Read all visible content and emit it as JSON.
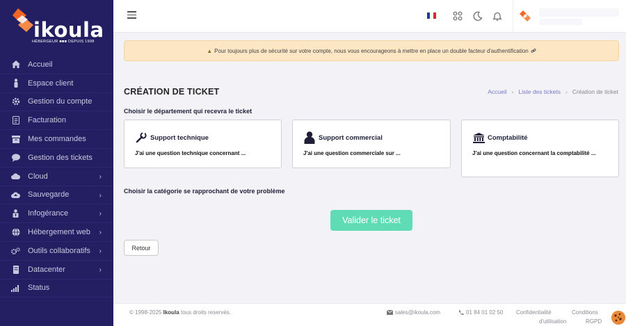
{
  "brand": {
    "name": "ikoula",
    "tagline": "HÉBERGEUR ■■■ DEPUIS 1998",
    "accent": "#f26522",
    "sidebar_bg": "#241f63"
  },
  "sidebar": {
    "items": [
      {
        "label": "Accueil",
        "icon": "home-icon",
        "has_submenu": false
      },
      {
        "label": "Espace client",
        "icon": "user-icon",
        "has_submenu": false
      },
      {
        "label": "Gestion du compte",
        "icon": "gear-icon",
        "has_submenu": false
      },
      {
        "label": "Facturation",
        "icon": "invoice-icon",
        "has_submenu": false
      },
      {
        "label": "Mes commandes",
        "icon": "box-icon",
        "has_submenu": false
      },
      {
        "label": "Gestion des tickets",
        "icon": "chat-icon",
        "has_submenu": false
      },
      {
        "label": "Cloud",
        "icon": "cloud-icon",
        "has_submenu": true
      },
      {
        "label": "Sauvegarde",
        "icon": "cloud-upload-icon",
        "has_submenu": true
      },
      {
        "label": "Infogérance",
        "icon": "person-tie-icon",
        "has_submenu": true
      },
      {
        "label": "Hébergement web",
        "icon": "globe-icon",
        "has_submenu": true
      },
      {
        "label": "Outils collaboratifs",
        "icon": "gears-icon",
        "has_submenu": true
      },
      {
        "label": "Datacenter",
        "icon": "server-icon",
        "has_submenu": true
      },
      {
        "label": "Status",
        "icon": "signal-icon",
        "has_submenu": false
      }
    ]
  },
  "topbar": {
    "menu_icon": "hamburger-icon",
    "language_flag": "france-flag-icon",
    "apps_icon": "grid-icon",
    "theme_icon": "moon-icon",
    "notifications_icon": "bell-icon"
  },
  "alert": {
    "text": "Pour toujours plus de sécurité sur votre compte, nous vous encourageons à mettre en place un double facteur d'authentification",
    "icon": "warning-icon",
    "link_icon": "link-icon"
  },
  "page": {
    "title": "CRÉATION DE TICKET",
    "breadcrumb": [
      "Accueil",
      "Liste des tickets",
      "Création de ticket"
    ],
    "department_label": "Choisir le département qui recevra le ticket",
    "category_label": "Choisir la catégorie se rapprochant de votre problème",
    "departments": [
      {
        "title": "Support technique",
        "description": "J'ai une question technique concernant ...",
        "icon": "tools-icon"
      },
      {
        "title": "Support commercial",
        "description": "J'ai une question commerciale sur ...",
        "icon": "person-icon"
      },
      {
        "title": "Comptabilité",
        "description": "J'ai une question concernant la comptabilité ...",
        "icon": "bank-icon"
      }
    ],
    "validate_button": "Valider le ticket",
    "back_button": "Retour"
  },
  "footer": {
    "copyright_prefix": "© 1998-2025",
    "copyright_brand": "Ikoula",
    "copyright_suffix": "tous droits reservés.",
    "email": "sales@ikoula.com",
    "phone": "01 84 01 02 50",
    "privacy": "Confidentialité",
    "terms_line1": "Conditions",
    "terms_line2": "d'utilisation",
    "gdpr": "RGPD"
  }
}
